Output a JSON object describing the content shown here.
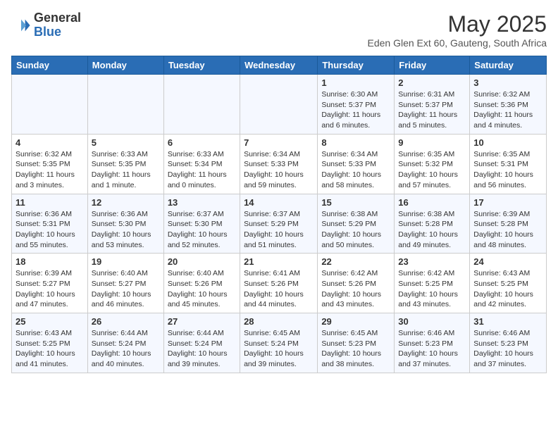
{
  "logo": {
    "text_general": "General",
    "text_blue": "Blue"
  },
  "title": "May 2025",
  "subtitle": "Eden Glen Ext 60, Gauteng, South Africa",
  "headers": [
    "Sunday",
    "Monday",
    "Tuesday",
    "Wednesday",
    "Thursday",
    "Friday",
    "Saturday"
  ],
  "weeks": [
    [
      {
        "day": "",
        "info": ""
      },
      {
        "day": "",
        "info": ""
      },
      {
        "day": "",
        "info": ""
      },
      {
        "day": "",
        "info": ""
      },
      {
        "day": "1",
        "info": "Sunrise: 6:30 AM\nSunset: 5:37 PM\nDaylight: 11 hours\nand 6 minutes."
      },
      {
        "day": "2",
        "info": "Sunrise: 6:31 AM\nSunset: 5:37 PM\nDaylight: 11 hours\nand 5 minutes."
      },
      {
        "day": "3",
        "info": "Sunrise: 6:32 AM\nSunset: 5:36 PM\nDaylight: 11 hours\nand 4 minutes."
      }
    ],
    [
      {
        "day": "4",
        "info": "Sunrise: 6:32 AM\nSunset: 5:35 PM\nDaylight: 11 hours\nand 3 minutes."
      },
      {
        "day": "5",
        "info": "Sunrise: 6:33 AM\nSunset: 5:35 PM\nDaylight: 11 hours\nand 1 minute."
      },
      {
        "day": "6",
        "info": "Sunrise: 6:33 AM\nSunset: 5:34 PM\nDaylight: 11 hours\nand 0 minutes."
      },
      {
        "day": "7",
        "info": "Sunrise: 6:34 AM\nSunset: 5:33 PM\nDaylight: 10 hours\nand 59 minutes."
      },
      {
        "day": "8",
        "info": "Sunrise: 6:34 AM\nSunset: 5:33 PM\nDaylight: 10 hours\nand 58 minutes."
      },
      {
        "day": "9",
        "info": "Sunrise: 6:35 AM\nSunset: 5:32 PM\nDaylight: 10 hours\nand 57 minutes."
      },
      {
        "day": "10",
        "info": "Sunrise: 6:35 AM\nSunset: 5:31 PM\nDaylight: 10 hours\nand 56 minutes."
      }
    ],
    [
      {
        "day": "11",
        "info": "Sunrise: 6:36 AM\nSunset: 5:31 PM\nDaylight: 10 hours\nand 55 minutes."
      },
      {
        "day": "12",
        "info": "Sunrise: 6:36 AM\nSunset: 5:30 PM\nDaylight: 10 hours\nand 53 minutes."
      },
      {
        "day": "13",
        "info": "Sunrise: 6:37 AM\nSunset: 5:30 PM\nDaylight: 10 hours\nand 52 minutes."
      },
      {
        "day": "14",
        "info": "Sunrise: 6:37 AM\nSunset: 5:29 PM\nDaylight: 10 hours\nand 51 minutes."
      },
      {
        "day": "15",
        "info": "Sunrise: 6:38 AM\nSunset: 5:29 PM\nDaylight: 10 hours\nand 50 minutes."
      },
      {
        "day": "16",
        "info": "Sunrise: 6:38 AM\nSunset: 5:28 PM\nDaylight: 10 hours\nand 49 minutes."
      },
      {
        "day": "17",
        "info": "Sunrise: 6:39 AM\nSunset: 5:28 PM\nDaylight: 10 hours\nand 48 minutes."
      }
    ],
    [
      {
        "day": "18",
        "info": "Sunrise: 6:39 AM\nSunset: 5:27 PM\nDaylight: 10 hours\nand 47 minutes."
      },
      {
        "day": "19",
        "info": "Sunrise: 6:40 AM\nSunset: 5:27 PM\nDaylight: 10 hours\nand 46 minutes."
      },
      {
        "day": "20",
        "info": "Sunrise: 6:40 AM\nSunset: 5:26 PM\nDaylight: 10 hours\nand 45 minutes."
      },
      {
        "day": "21",
        "info": "Sunrise: 6:41 AM\nSunset: 5:26 PM\nDaylight: 10 hours\nand 44 minutes."
      },
      {
        "day": "22",
        "info": "Sunrise: 6:42 AM\nSunset: 5:26 PM\nDaylight: 10 hours\nand 43 minutes."
      },
      {
        "day": "23",
        "info": "Sunrise: 6:42 AM\nSunset: 5:25 PM\nDaylight: 10 hours\nand 43 minutes."
      },
      {
        "day": "24",
        "info": "Sunrise: 6:43 AM\nSunset: 5:25 PM\nDaylight: 10 hours\nand 42 minutes."
      }
    ],
    [
      {
        "day": "25",
        "info": "Sunrise: 6:43 AM\nSunset: 5:25 PM\nDaylight: 10 hours\nand 41 minutes."
      },
      {
        "day": "26",
        "info": "Sunrise: 6:44 AM\nSunset: 5:24 PM\nDaylight: 10 hours\nand 40 minutes."
      },
      {
        "day": "27",
        "info": "Sunrise: 6:44 AM\nSunset: 5:24 PM\nDaylight: 10 hours\nand 39 minutes."
      },
      {
        "day": "28",
        "info": "Sunrise: 6:45 AM\nSunset: 5:24 PM\nDaylight: 10 hours\nand 39 minutes."
      },
      {
        "day": "29",
        "info": "Sunrise: 6:45 AM\nSunset: 5:23 PM\nDaylight: 10 hours\nand 38 minutes."
      },
      {
        "day": "30",
        "info": "Sunrise: 6:46 AM\nSunset: 5:23 PM\nDaylight: 10 hours\nand 37 minutes."
      },
      {
        "day": "31",
        "info": "Sunrise: 6:46 AM\nSunset: 5:23 PM\nDaylight: 10 hours\nand 37 minutes."
      }
    ]
  ]
}
